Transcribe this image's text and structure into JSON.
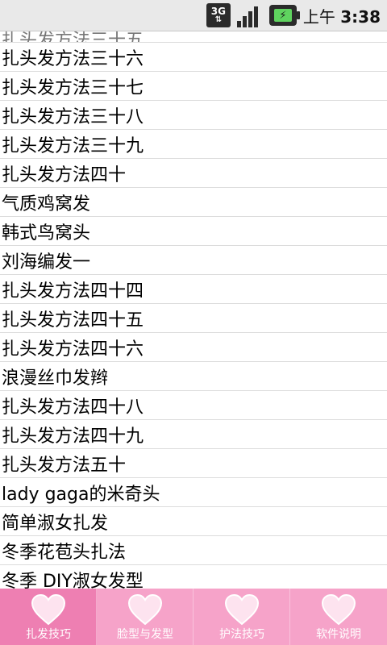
{
  "status_bar": {
    "network": "3G",
    "time_prefix": "上午",
    "time": "3:38"
  },
  "list": {
    "partial_item": "扎头发方法三十五",
    "items": [
      "扎头发方法三十六",
      "扎头发方法三十七",
      "扎头发方法三十八",
      "扎头发方法三十九",
      "扎头发方法四十",
      "气质鸡窝发",
      "韩式鸟窝头",
      "刘海编发一",
      "扎头发方法四十四",
      "扎头发方法四十五",
      "扎头发方法四十六",
      "浪漫丝巾发辫",
      "扎头发方法四十八",
      "扎头发方法四十九",
      "扎头发方法五十",
      "lady gaga的米奇头",
      "简单淑女扎发",
      "冬季花苞头扎法",
      "冬季 DIY淑女发型"
    ]
  },
  "tabs": [
    {
      "label": "扎发技巧",
      "icon": "heart-icon",
      "active": true
    },
    {
      "label": "脸型与发型",
      "icon": "heart-icon",
      "active": false
    },
    {
      "label": "护法技巧",
      "icon": "heart-icon",
      "active": false
    },
    {
      "label": "软件说明",
      "icon": "heart-icon",
      "active": false
    }
  ],
  "colors": {
    "tab_bar": "#f6a3c9",
    "tab_active": "#ee7fb2",
    "heart": "#fde3ef"
  }
}
